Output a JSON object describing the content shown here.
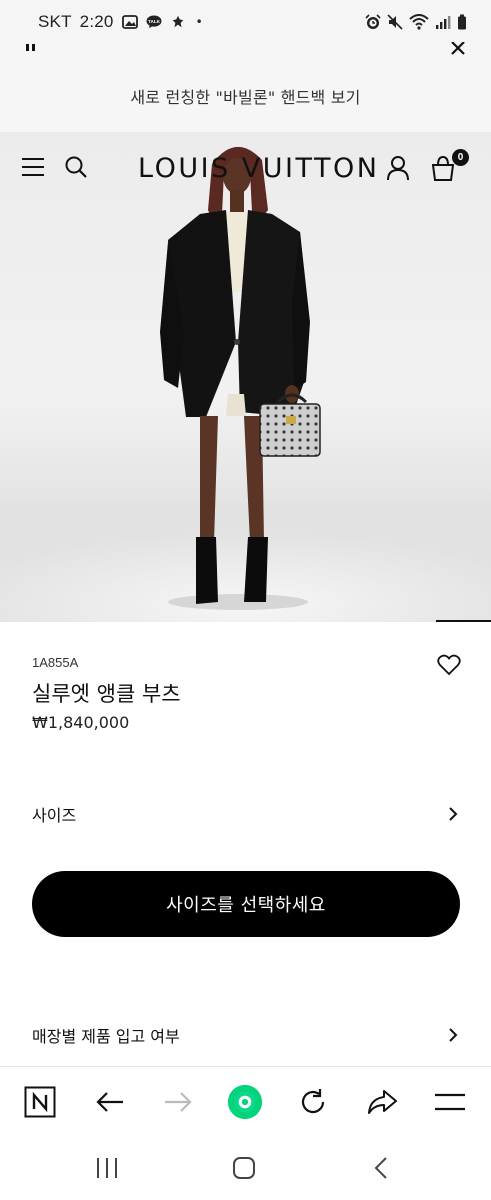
{
  "status_bar": {
    "carrier": "SKT",
    "time": "2:20",
    "dot": "•"
  },
  "banner": {
    "text": "새로 런칭한 \"바빌론\" 핸드백 보기"
  },
  "header": {
    "brand": "LOUIS VUITTON",
    "bag_count": "0"
  },
  "product": {
    "sku": "1A855A",
    "name": "실루엣 앵클 부츠",
    "price": "₩1,840,000"
  },
  "size_row": {
    "label": "사이즈"
  },
  "select_size_button": {
    "label": "사이즈를 선택하세요"
  },
  "store_availability_row": {
    "label": "매장별 제품 입고 여부"
  },
  "colors": {
    "brand_black": "#000000",
    "naver_green": "#03c75a"
  }
}
